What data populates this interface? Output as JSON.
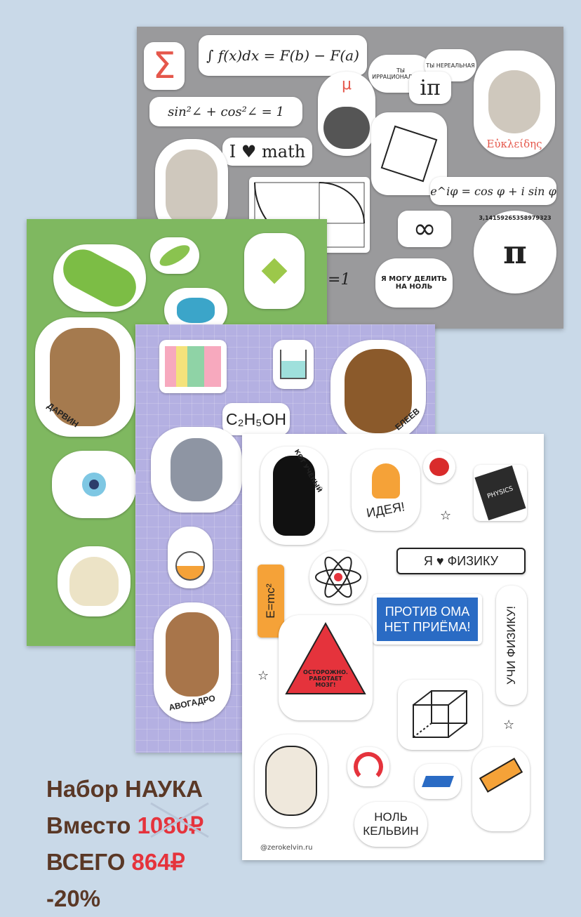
{
  "math_sheet": {
    "integral": "∫ f(x)dx = F(b) − F(a)",
    "trig": "sin²∠ + cos²∠ = 1",
    "love_math": "I ♥ math",
    "irrational": "ТЫ ИРРАЦИОНАЛЬНЫЙ",
    "unreal": "ТЫ НЕРЕАЛЬНАЯ",
    "i_pi": "iπ",
    "mu": "μ",
    "euler": "e^iφ = cos φ + i sin φ",
    "euclid": "Εὐκλείδης",
    "pi_digits": "3,14159265358979323",
    "pi": "π",
    "divide_zero": "Я МОГУ ДЕЛИТЬ НА НОЛЬ",
    "eq_one": "=1"
  },
  "bio_sheet": {
    "darwin": "ДАРВИН"
  },
  "chem_sheet": {
    "ethanol": "C₂H₅OH",
    "mendeleev": "ЕЛЕЕВ",
    "avogadro": "АВОГАДРО"
  },
  "phys_sheet": {
    "cat": "КОТ УЧЁНЫЙ",
    "idea": "ИДЕЯ!",
    "physics_book": "PHYSICS",
    "love_physics": "Я ♥ ФИЗИКУ",
    "emc": "E=mc²",
    "ohm": "ПРОТИВ ОМА НЕТ ПРИЁМА!",
    "learn": "УЧИ ФИЗИКУ!",
    "warning": "ОСТОРОЖНО. РАБОТАЕТ МОЗГ!",
    "zero_kelvin": "НОЛЬ КЕЛЬВИН",
    "site": "@zerokelvin.ru"
  },
  "promo": {
    "line1": "Набор НАУКА",
    "line2_prefix": "Вместо",
    "old_price": "1080₽",
    "line3_prefix": "ВСЕГО",
    "new_price": "864₽",
    "discount": "-20%"
  },
  "colors": {
    "background": "#c9d9e8",
    "math_sheet": "#9a9a9c",
    "bio_sheet": "#7fb860",
    "chem_sheet": "#b4b0e2",
    "promo_text": "#5a3826",
    "accent_red": "#e5333c",
    "ohm_blue": "#2a6bc4"
  }
}
